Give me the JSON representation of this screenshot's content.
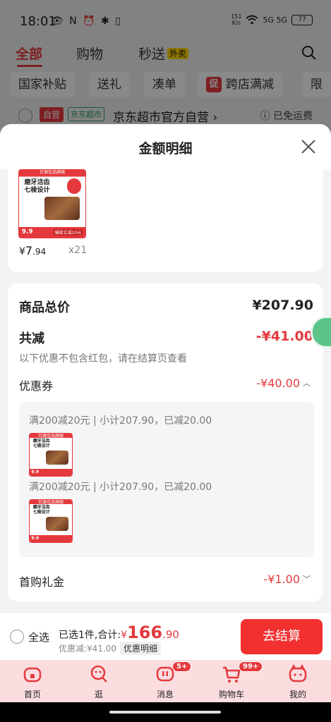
{
  "status_bar": {
    "time": "18:01",
    "left_icons": "👁 N ⏰ ✱ ▯",
    "net_speed_top": "151",
    "net_speed_bottom": "K/s",
    "signal": "5G 5G",
    "battery": "77"
  },
  "top_tabs": {
    "items": [
      "全部",
      "购物",
      "秒送"
    ],
    "waimai_tag": "外卖"
  },
  "filter_chips": [
    "国家补贴",
    "送礼",
    "凑单",
    "跨店满减",
    "限"
  ],
  "promo_chip_badge": "促",
  "store_row": {
    "self_tag": "自营",
    "channel_tag": "京东超市",
    "store_name": "京东超市官方自营 ›",
    "shipping": "ⓘ 已免运费"
  },
  "sheet": {
    "title": "金额明细",
    "product": {
      "image": {
        "top_brand": "甘源佳品旗舰",
        "headline_1": "磨牙洁齿",
        "headline_2": "七棱设计",
        "price_tag": "9.9",
        "promo_tag": "爆款立减10元"
      },
      "price_yen": "¥",
      "price_int": "7",
      "price_dec": ".94",
      "quantity": "x21"
    },
    "summary": {
      "total_label": "商品总价",
      "total_value": "¥207.90",
      "reduce_label": "共减",
      "reduce_value": "-¥41.00",
      "reduce_note": "以下优惠不包含红包，请在结算页查看",
      "coupon_label": "优惠券",
      "coupon_value": "-¥40.00",
      "coupon_lines": [
        "满200减20元 | 小计207.90，已减20.00",
        "满200减20元 | 小计207.90，已减20.00"
      ],
      "gift_label": "首购礼金",
      "gift_value": "-¥1.00"
    }
  },
  "checkout": {
    "select_all": "全选",
    "selected_text": "已选1件,合计:",
    "total_yen": "¥",
    "total_int": "166",
    "total_dec": ".90",
    "saved_text": "优惠减:¥41.00",
    "detail_button": "优惠明细",
    "checkout_button": "去结算"
  },
  "bottom_nav": {
    "items": [
      "首页",
      "逛",
      "消息",
      "购物车",
      "我的"
    ],
    "message_badge": "5+",
    "cart_badge": "99+"
  },
  "colors": {
    "brand_red": "#e4393c",
    "checkout_red": "#f23030",
    "nav_bg": "#fbdde0"
  }
}
